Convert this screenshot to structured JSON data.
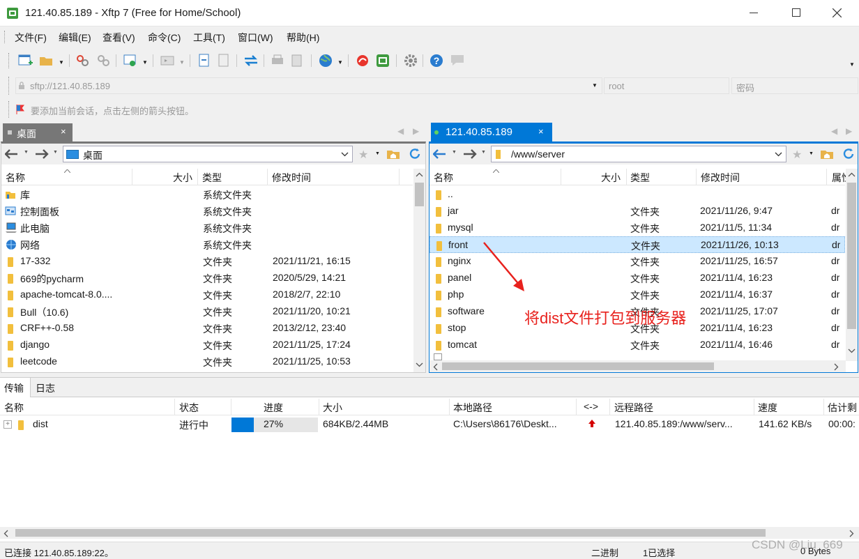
{
  "window": {
    "title": "121.40.85.189 - Xftp 7 (Free for Home/School)"
  },
  "menu": [
    "文件(F)",
    "编辑(E)",
    "查看(V)",
    "命令(C)",
    "工具(T)",
    "窗口(W)",
    "帮助(H)"
  ],
  "address": {
    "url": "sftp://121.40.85.189",
    "user_placeholder": "root",
    "password_placeholder": "密码"
  },
  "session_hint": "要添加当前会话，点击左侧的箭头按钮。",
  "local_tab": {
    "label": "桌面"
  },
  "remote_tab": {
    "label": "121.40.85.189"
  },
  "local": {
    "path": "桌面",
    "headers": {
      "name": "名称",
      "size": "大小",
      "type": "类型",
      "modified": "修改时间"
    },
    "rows": [
      {
        "name": "库",
        "type": "系统文件夹",
        "modified": "",
        "icon": "library-icon"
      },
      {
        "name": "控制面板",
        "type": "系统文件夹",
        "modified": "",
        "icon": "control-panel-icon"
      },
      {
        "name": "此电脑",
        "type": "系统文件夹",
        "modified": "",
        "icon": "computer-icon"
      },
      {
        "name": "网络",
        "type": "系统文件夹",
        "modified": "",
        "icon": "network-icon"
      },
      {
        "name": "17-332",
        "type": "文件夹",
        "modified": "2021/11/21, 16:15",
        "icon": "folder-icon"
      },
      {
        "name": "669的pycharm",
        "type": "文件夹",
        "modified": "2020/5/29, 14:21",
        "icon": "folder-icon"
      },
      {
        "name": "apache-tomcat-8.0....",
        "type": "文件夹",
        "modified": "2018/2/7, 22:10",
        "icon": "folder-icon"
      },
      {
        "name": "Bull（10.6)",
        "type": "文件夹",
        "modified": "2021/11/20, 10:21",
        "icon": "folder-icon"
      },
      {
        "name": "CRF++-0.58",
        "type": "文件夹",
        "modified": "2013/2/12, 23:40",
        "icon": "folder-icon"
      },
      {
        "name": "django",
        "type": "文件夹",
        "modified": "2021/11/25, 17:24",
        "icon": "folder-icon"
      },
      {
        "name": "leetcode",
        "type": "文件夹",
        "modified": "2021/11/25, 10:53",
        "icon": "folder-icon"
      }
    ]
  },
  "remote": {
    "path": "/www/server",
    "headers": {
      "name": "名称",
      "size": "大小",
      "type": "类型",
      "modified": "修改时间",
      "attr": "属性"
    },
    "rows": [
      {
        "name": "..",
        "type": "",
        "modified": "",
        "attr": ""
      },
      {
        "name": "jar",
        "type": "文件夹",
        "modified": "2021/11/26, 9:47",
        "attr": "dr"
      },
      {
        "name": "mysql",
        "type": "文件夹",
        "modified": "2021/11/5, 11:34",
        "attr": "dr"
      },
      {
        "name": "front",
        "type": "文件夹",
        "modified": "2021/11/26, 10:13",
        "attr": "dr"
      },
      {
        "name": "nginx",
        "type": "文件夹",
        "modified": "2021/11/25, 16:57",
        "attr": "dr"
      },
      {
        "name": "panel",
        "type": "文件夹",
        "modified": "2021/11/4, 16:23",
        "attr": "dr"
      },
      {
        "name": "php",
        "type": "文件夹",
        "modified": "2021/11/4, 16:37",
        "attr": "dr"
      },
      {
        "name": "software",
        "type": "文件夹",
        "modified": "2021/11/25, 17:07",
        "attr": "dr"
      },
      {
        "name": "stop",
        "type": "文件夹",
        "modified": "2021/11/4, 16:23",
        "attr": "dr"
      },
      {
        "name": "tomcat",
        "type": "文件夹",
        "modified": "2021/11/4, 16:46",
        "attr": "dr"
      }
    ],
    "selected_index": 3
  },
  "annotation": {
    "text": "将dist文件打包到服务器",
    "color": "#e8211d"
  },
  "bottom_tabs": [
    "传输",
    "日志"
  ],
  "transfer": {
    "headers": {
      "name": "名称",
      "status": "状态",
      "progress": "进度",
      "size": "大小",
      "local": "本地路径",
      "dir": "<->",
      "remote": "远程路径",
      "speed": "速度",
      "eta": "估计剩"
    },
    "rows": [
      {
        "name": "dist",
        "status": "进行中",
        "progress_pct": 27,
        "progress_text": "27%",
        "size": "684KB/2.44MB",
        "local": "C:\\Users\\86176\\Deskt...",
        "remote": "121.40.85.189:/www/serv...",
        "speed": "141.62 KB/s",
        "eta": "00:00:"
      }
    ]
  },
  "status": {
    "connection": "已连接 121.40.85.189:22。",
    "mode": "二进制",
    "selection": "1已选择",
    "bytes": "0 Bytes"
  },
  "watermark": "CSDN @Liu_669",
  "colors": {
    "accent": "#0078d7",
    "tab_active": "#0078d7",
    "selection_bg": "#cce8ff",
    "annotation": "#e8211d"
  }
}
